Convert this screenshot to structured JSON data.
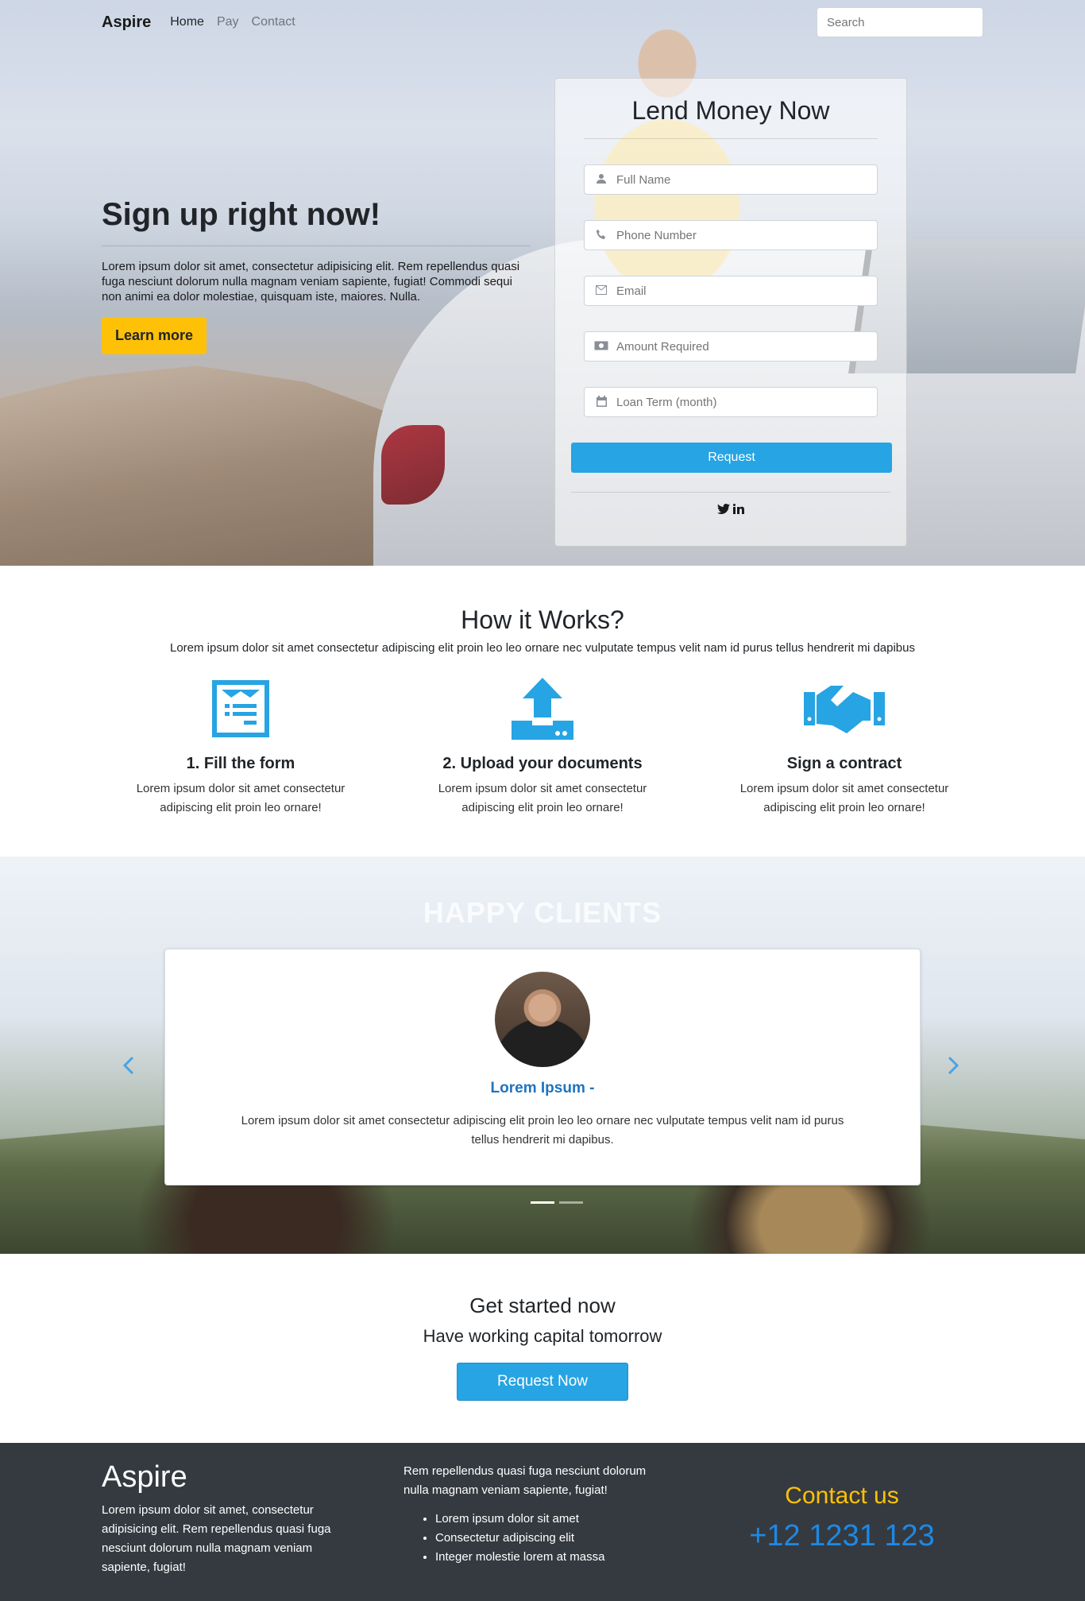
{
  "nav": {
    "brand": "Aspire",
    "links": [
      "Home",
      "Pay",
      "Contact"
    ],
    "search_placeholder": "Search"
  },
  "hero": {
    "title": "Sign up right now!",
    "paragraph": "Lorem ipsum dolor sit amet, consectetur adipisicing elit. Rem repellendus quasi fuga nesciunt dolorum nulla magnam veniam sapiente, fugiat! Commodi sequi non animi ea dolor molestiae, quisquam iste, maiores. Nulla.",
    "cta_label": "Learn more"
  },
  "lend_form": {
    "title": "Lend Money Now",
    "fields": [
      {
        "icon": "user-icon",
        "placeholder": "Full Name"
      },
      {
        "icon": "phone-icon",
        "placeholder": "Phone Number"
      },
      {
        "icon": "envelope-icon",
        "placeholder": "Email"
      },
      {
        "icon": "money-icon",
        "placeholder": "Amount Required"
      },
      {
        "icon": "calendar-icon",
        "placeholder": "Loan Term (month)"
      }
    ],
    "submit_label": "Request",
    "social": [
      "twitter-icon",
      "linkedin-icon"
    ]
  },
  "how": {
    "title": "How it Works?",
    "subtitle": "Lorem ipsum dolor sit amet consectetur adipiscing elit proin leo leo ornare nec vulputate tempus velit nam id purus tellus hendrerit mi dapibus",
    "steps": [
      {
        "icon": "form-icon",
        "title": "1. Fill the form",
        "text": "Lorem ipsum dolor sit amet consectetur adipiscing elit proin leo ornare!"
      },
      {
        "icon": "upload-icon",
        "title": "2. Upload your documents",
        "text": "Lorem ipsum dolor sit amet consectetur adipiscing elit proin leo ornare!"
      },
      {
        "icon": "handshake-icon",
        "title": "Sign a contract",
        "text": "Lorem ipsum dolor sit amet consectetur adipiscing elit proin leo ornare!"
      }
    ]
  },
  "clients": {
    "title": "HAPPY CLIENTS",
    "testimonial": {
      "name": "Lorem Ipsum -",
      "text": "Lorem ipsum dolor sit amet consectetur adipiscing elit proin leo leo ornare nec vulputate tempus velit nam id purus tellus hendrerit mi dapibus."
    },
    "indicators": 2,
    "active_indicator": 0
  },
  "cta": {
    "title": "Get started now",
    "subtitle": "Have working capital tomorrow",
    "button_label": "Request Now"
  },
  "footer": {
    "brand": "Aspire",
    "about": "Lorem ipsum dolor sit amet, consectetur adipisicing elit. Rem repellendus quasi fuga nesciunt dolorum nulla magnam veniam sapiente, fugiat!",
    "middle_text": "Rem repellendus quasi fuga nesciunt dolorum nulla magnam veniam sapiente, fugiat!",
    "list": [
      "Lorem ipsum dolor sit amet",
      "Consectetur adipiscing elit",
      "Integer molestie lorem at massa"
    ],
    "contact_label": "Contact us",
    "phone": "+12 1231 123"
  },
  "colors": {
    "accent_blue": "#26a4e3",
    "cta_yellow": "#ffc107",
    "footer_bg": "#343a40",
    "phone_blue": "#1e88e5",
    "testimonial_name": "#1e73be"
  }
}
